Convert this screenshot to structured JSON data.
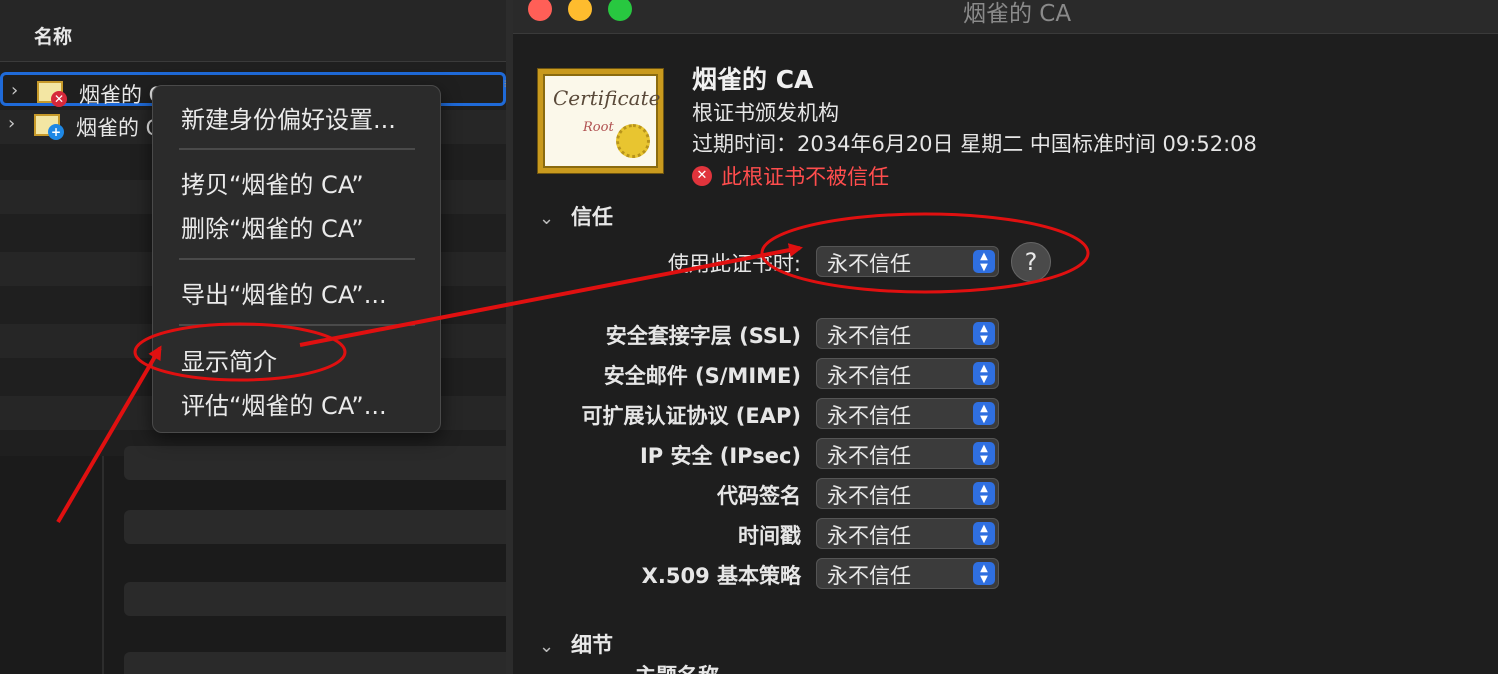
{
  "list": {
    "column_name": "名称",
    "rows": [
      {
        "label": "烟雀的 CA",
        "badge": "✕"
      },
      {
        "label": "烟雀的 CA",
        "badge": "+"
      }
    ]
  },
  "context_menu": {
    "items": [
      "新建身份偏好设置...",
      "拷贝“烟雀的 CA”",
      "删除“烟雀的 CA”",
      "导出“烟雀的 CA”...",
      "显示简介",
      "评估“烟雀的 CA”..."
    ]
  },
  "window": {
    "title": "烟雀的 CA"
  },
  "certificate": {
    "image_script": "Certificate",
    "image_root": "Root",
    "name": "烟雀的 CA",
    "kind": "根证书颁发机构",
    "expiry": "过期时间：2034年6月20日 星期二 中国标准时间 09:52:08",
    "status": "此根证书不被信任",
    "status_color": "#ff4d4d"
  },
  "trust": {
    "section_label": "信任",
    "use_label": "使用此证书时:",
    "use_value": "永不信任",
    "help": "?",
    "policies": [
      {
        "label": "安全套接字层 (SSL)",
        "value": "永不信任"
      },
      {
        "label": "安全邮件 (S/MIME)",
        "value": "永不信任"
      },
      {
        "label": "可扩展认证协议 (EAP)",
        "value": "永不信任"
      },
      {
        "label": "IP 安全 (IPsec)",
        "value": "永不信任"
      },
      {
        "label": "代码签名",
        "value": "永不信任"
      },
      {
        "label": "时间戳",
        "value": "永不信任"
      },
      {
        "label": "X.509 基本策略",
        "value": "永不信任"
      }
    ]
  },
  "details": {
    "section_label": "细节",
    "first_field_cut": "主题名称"
  },
  "annotation_color": "#e01010"
}
